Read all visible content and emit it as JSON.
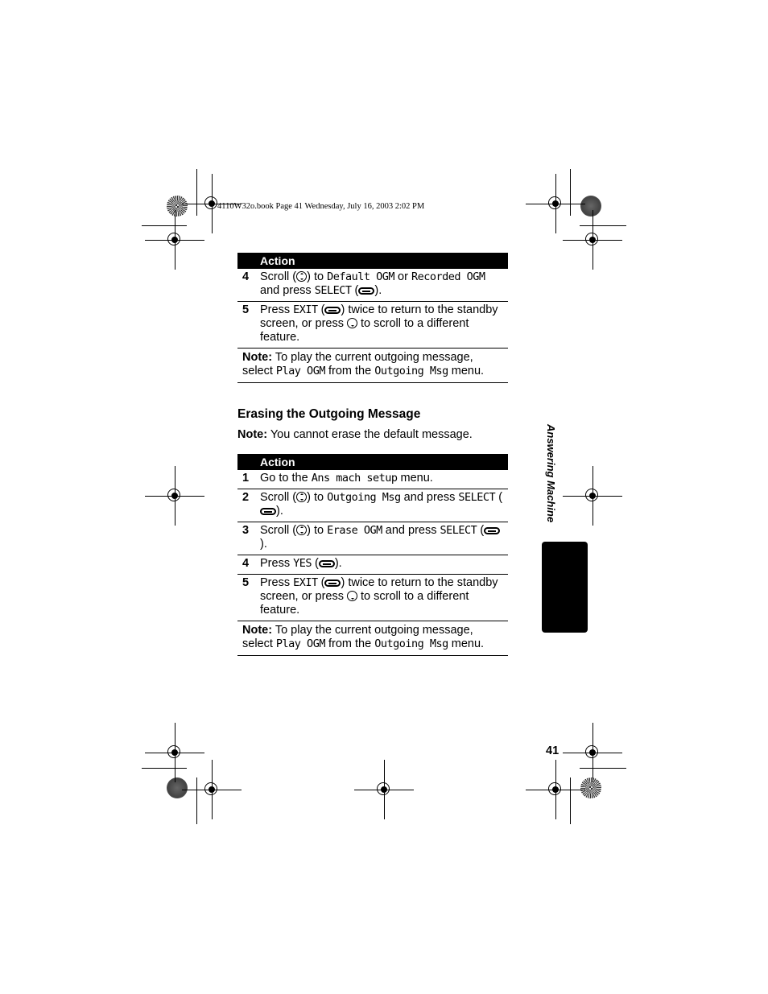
{
  "print_header": "4110W32o.book  Page 41  Wednesday, July 16, 2003  2:02 PM",
  "table1": {
    "header": "Action",
    "rows": [
      {
        "num": "4",
        "parts": [
          "Scroll (",
          "[nav]",
          ") to ",
          "{Default OGM}",
          " or ",
          "{Recorded OGM}",
          " and press ",
          "{SELECT}",
          " (",
          "[key]",
          ")."
        ]
      },
      {
        "num": "5",
        "parts": [
          "Press ",
          "{EXIT}",
          " (",
          "[key]",
          ") twice to return to the standby screen, or press ",
          "[navdown]",
          " to scroll to a different feature."
        ]
      }
    ],
    "note_label": "Note:",
    "note_parts": [
      " To play the current outgoing message, select ",
      "{Play OGM}",
      " from the ",
      "{Outgoing Msg}",
      " menu."
    ]
  },
  "section": {
    "title": "Erasing the Outgoing Message",
    "note_label": "Note:",
    "note_text": " You cannot erase the default message."
  },
  "table2": {
    "header": "Action",
    "rows": [
      {
        "num": "1",
        "parts": [
          "Go to the ",
          "{Ans mach setup}",
          " menu."
        ]
      },
      {
        "num": "2",
        "parts": [
          "Scroll (",
          "[nav]",
          ") to ",
          "{Outgoing Msg}",
          " and press ",
          "{SELECT}",
          " (",
          "[key]",
          ")."
        ]
      },
      {
        "num": "3",
        "parts": [
          "Scroll (",
          "[nav]",
          ") to ",
          "{Erase OGM}",
          " and press ",
          "{SELECT}",
          " (",
          "[key]",
          ")."
        ]
      },
      {
        "num": "4",
        "parts": [
          "Press ",
          "{YES}",
          " (",
          "[key]",
          ")."
        ]
      },
      {
        "num": "5",
        "parts": [
          "Press ",
          "{EXIT}",
          " (",
          "[key]",
          ") twice to return to the standby screen, or press ",
          "[navdown]",
          " to scroll to a different feature."
        ]
      }
    ],
    "note_label": "Note:",
    "note_parts": [
      " To play the current outgoing message, select ",
      "{Play OGM}",
      " from the ",
      "{Outgoing Msg}",
      " menu."
    ]
  },
  "side_tab_label": "Answering Machine",
  "page_number": "41",
  "icons": {
    "nav": "scroll-key-icon",
    "navdown": "scroll-down-key-icon",
    "key": "soft-key-icon"
  }
}
